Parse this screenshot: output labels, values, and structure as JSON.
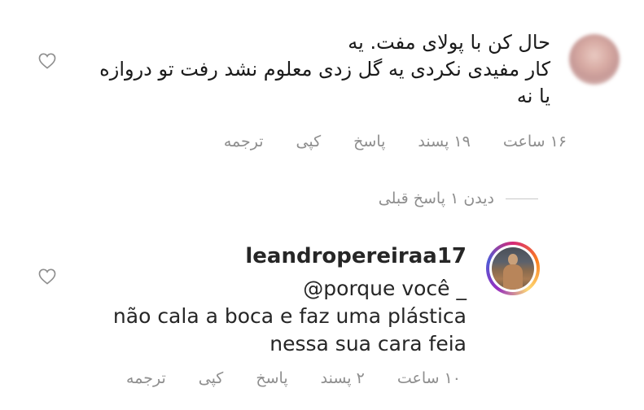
{
  "comment1": {
    "text_lines": [
      "حال کن با پولای مفت. یه",
      "کار مفیدی نکردی یه گل زدی معلوم نشد رفت تو دروازه",
      "یا نه"
    ],
    "time": "۱۶ ساعت",
    "likes": "۱۹ پسند",
    "reply_label": "پاسخ",
    "copy_label": "کپی",
    "translate_label": "ترجمه"
  },
  "view_replies_label": "دیدن ۱ پاسخ قبلی",
  "comment2": {
    "username": "leandropereiraa17",
    "mention_line": "@porque você _",
    "text_lines": [
      "não cala a boca e faz uma plástica",
      "nessa sua cara feia"
    ],
    "time": "۱۰ ساعت",
    "likes": "۲ پسند",
    "reply_label": "پاسخ",
    "copy_label": "کپی",
    "translate_label": "ترجمه"
  },
  "icons": {
    "like": "heart-outline-icon",
    "avatar1": "blurred-avatar",
    "avatar2": "story-ring-avatar"
  },
  "colors": {
    "text": "#262626",
    "meta": "#8e8e8e",
    "story_ring": "#d62976"
  }
}
